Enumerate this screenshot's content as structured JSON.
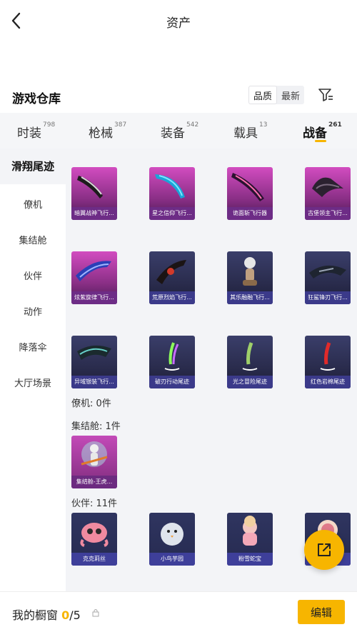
{
  "header": {
    "title": "资产"
  },
  "section": {
    "title": "游戏仓库",
    "sort": [
      "品质",
      "最新"
    ]
  },
  "tabs": [
    {
      "label": "时装",
      "count": "798"
    },
    {
      "label": "枪械",
      "count": "387"
    },
    {
      "label": "装备",
      "count": "542"
    },
    {
      "label": "载具",
      "count": "13"
    },
    {
      "label": "战备",
      "count": "261"
    }
  ],
  "sidebar": [
    "滑翔尾迹",
    "僚机",
    "集结舱",
    "伙伴",
    "动作",
    "降落伞",
    "大厅场景"
  ],
  "glide_items": [
    "暗翼战神飞行...",
    "星之信仰飞行...",
    "诡面斩飞行器",
    "古堡领主飞行...",
    "炫紫旋律飞行...",
    "荒原烈焰飞行...",
    "其乐融融飞行...",
    "狂鲨锋刃飞行...",
    "异域银装飞行...",
    "破刃行动尾迹",
    "光之冒险尾迹",
    "红色岩棉尾迹"
  ],
  "groups": {
    "wingman": "僚机: 0件",
    "capsule": "集结舱: 1件",
    "partner": "伙伴: 11件"
  },
  "capsule_items": [
    "集结舱-王虎..."
  ],
  "partner_items": [
    "克克莉丝",
    "小鸟芋园",
    "粉雪蛇宝",
    ""
  ],
  "bottom": {
    "showcase_label": "我的橱窗",
    "count": "0",
    "total": "/5",
    "edit": "编辑"
  },
  "colors": {
    "accent": "#f7b500"
  }
}
